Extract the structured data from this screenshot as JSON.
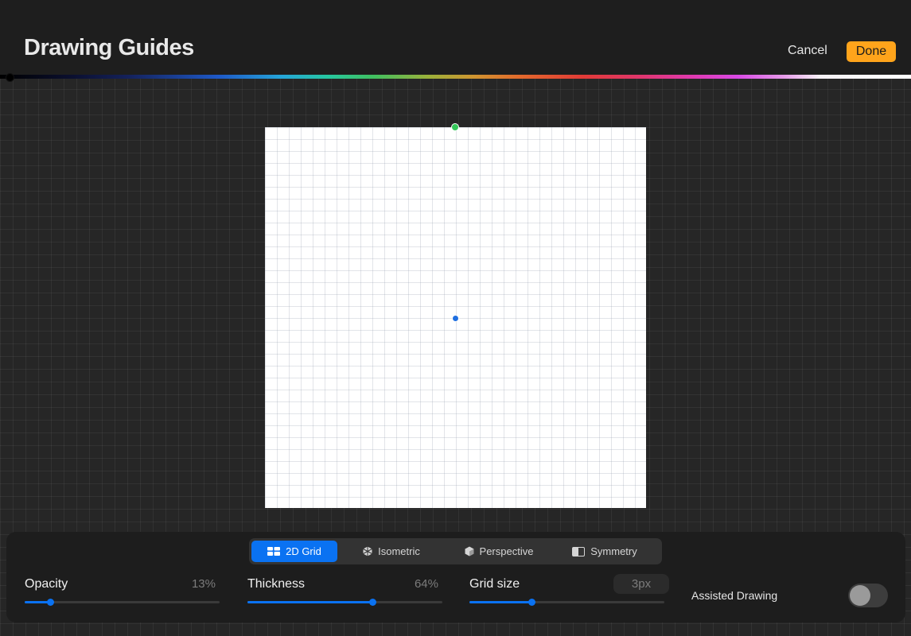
{
  "header": {
    "title": "Drawing Guides",
    "cancel_label": "Cancel",
    "done_label": "Done",
    "accent_color": "#ffa41b"
  },
  "guide_types": {
    "selected": "2D Grid",
    "tabs": [
      {
        "label": "2D Grid",
        "icon": "grid-icon"
      },
      {
        "label": "Isometric",
        "icon": "isometric-icon"
      },
      {
        "label": "Perspective",
        "icon": "perspective-icon"
      },
      {
        "label": "Symmetry",
        "icon": "symmetry-icon"
      }
    ]
  },
  "sliders": {
    "opacity": {
      "label": "Opacity",
      "value": "13%",
      "fraction": 0.13
    },
    "thickness": {
      "label": "Thickness",
      "value": "64%",
      "fraction": 0.64
    },
    "grid_size": {
      "label": "Grid size",
      "value": "3px",
      "fraction": 0.32
    }
  },
  "assisted_drawing": {
    "label": "Assisted Drawing",
    "enabled": false
  },
  "colors": {
    "slider_accent": "#0a72f2",
    "rotate_handle": "#34c759",
    "center_handle": "#1f6fe0"
  }
}
